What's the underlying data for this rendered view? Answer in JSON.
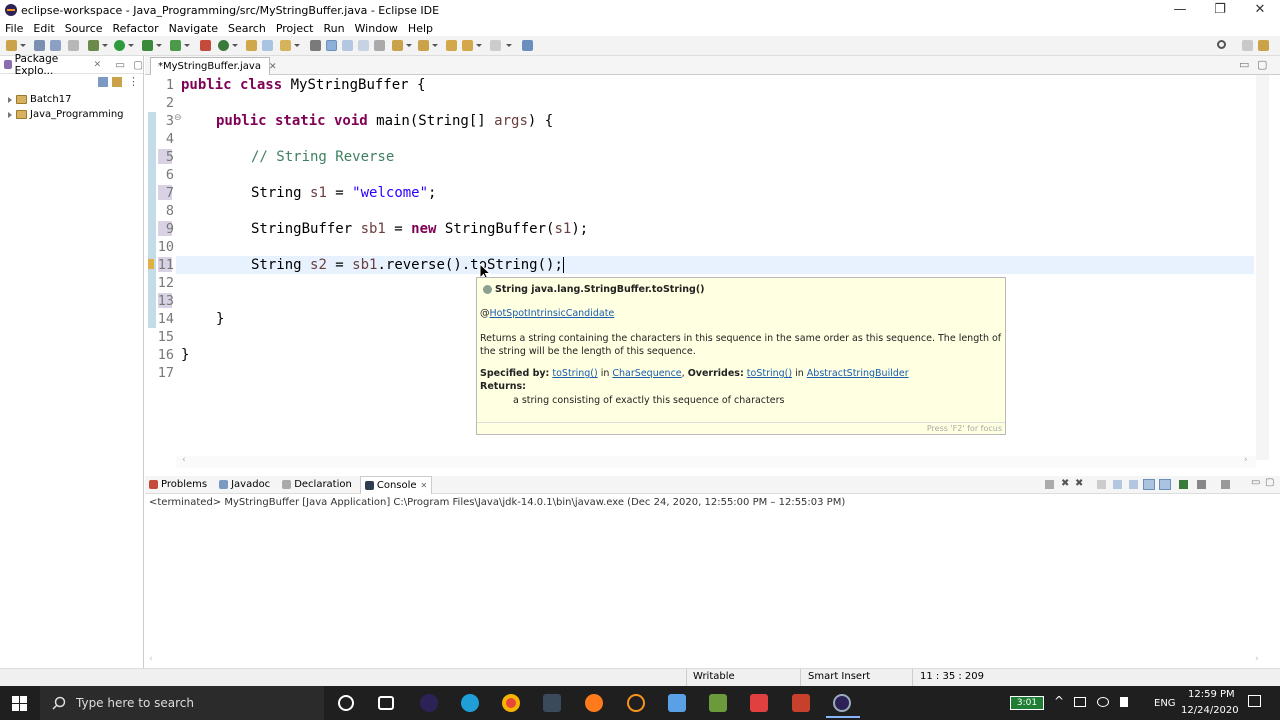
{
  "window": {
    "title": "eclipse-workspace - Java_Programming/src/MyStringBuffer.java - Eclipse IDE",
    "minimize": "—",
    "maximize": "❐",
    "close": "✕"
  },
  "menu": [
    "File",
    "Edit",
    "Source",
    "Refactor",
    "Navigate",
    "Search",
    "Project",
    "Run",
    "Window",
    "Help"
  ],
  "package_explorer": {
    "tab_label": "Package Explo...",
    "items": [
      "Batch17",
      "Java_Programming"
    ]
  },
  "editor": {
    "tab_label": "*MyStringBuffer.java",
    "line_numbers": [
      "1",
      "2",
      "3",
      "4",
      "5",
      "6",
      "7",
      "8",
      "9",
      "10",
      "11",
      "12",
      "13",
      "14",
      "15",
      "16",
      "17"
    ],
    "line3_fold": "⊖",
    "code": {
      "l1_kw": "public class",
      "l1_rest": " MyStringBuffer {",
      "l3_kw": "public static void",
      "l3_rest": " main(String[] ",
      "l3_var": "args",
      "l3_end": ") {",
      "l5_comment": "// String Reverse",
      "l7_type": "String ",
      "l7_var": "s1",
      "l7_eq": " = ",
      "l7_str": "\"welcome\"",
      "l7_end": ";",
      "l9_type": "StringBuffer ",
      "l9_var": "sb1",
      "l9_eq": " = ",
      "l9_kw": "new",
      "l9_rest": " StringBuffer(",
      "l9_arg": "s1",
      "l9_end": ");",
      "l11_type": "String ",
      "l11_var": "s2",
      "l11_eq": " = ",
      "l11_var2": "sb1",
      "l11_rest": ".reverse().toString();",
      "l14": "}",
      "l16": "}"
    }
  },
  "tooltip": {
    "header": "String java.lang.StringBuffer.toString()",
    "annotation_at": "@",
    "annotation_link": "HotSpotIntrinsicCandidate",
    "description": "Returns a string containing the characters in this sequence in the same order as this sequence. The length of the string will be the length of this sequence.",
    "specified_by_label": "Specified by:",
    "specified_link": "toString()",
    "in1": " in ",
    "specified_in_link": "CharSequence",
    "comma": ", ",
    "overrides_label": "Overrides:",
    "overrides_link": "toString()",
    "in2": " in ",
    "overrides_in_link": "AbstractStringBuilder",
    "returns_label": "Returns:",
    "returns_text": "a string consisting of exactly this sequence of characters",
    "footer": "Press 'F2' for focus"
  },
  "bottom_panel": {
    "tabs": [
      "Problems",
      "Javadoc",
      "Declaration",
      "Console"
    ],
    "console_close": "✕",
    "console_header": "<terminated> MyStringBuffer [Java Application] C:\\Program Files\\Java\\jdk-14.0.1\\bin\\javaw.exe  (Dec 24, 2020, 12:55:00 PM – 12:55:03 PM)"
  },
  "status": {
    "writable": "Writable",
    "insert_mode": "Smart Insert",
    "position": "11 : 35 : 209"
  },
  "taskbar": {
    "search_placeholder": "Type here to search",
    "battery": "3:01",
    "language": "ENG",
    "time": "12:59 PM",
    "date": "12/24/2020"
  },
  "colors": {
    "keyword": "#7f0055",
    "comment": "#3f7f5f",
    "string": "#2a00ff",
    "variable": "#6a3e3e",
    "tooltip_bg": "#ffffe1",
    "taskbar_bg": "#1f1f1f"
  }
}
